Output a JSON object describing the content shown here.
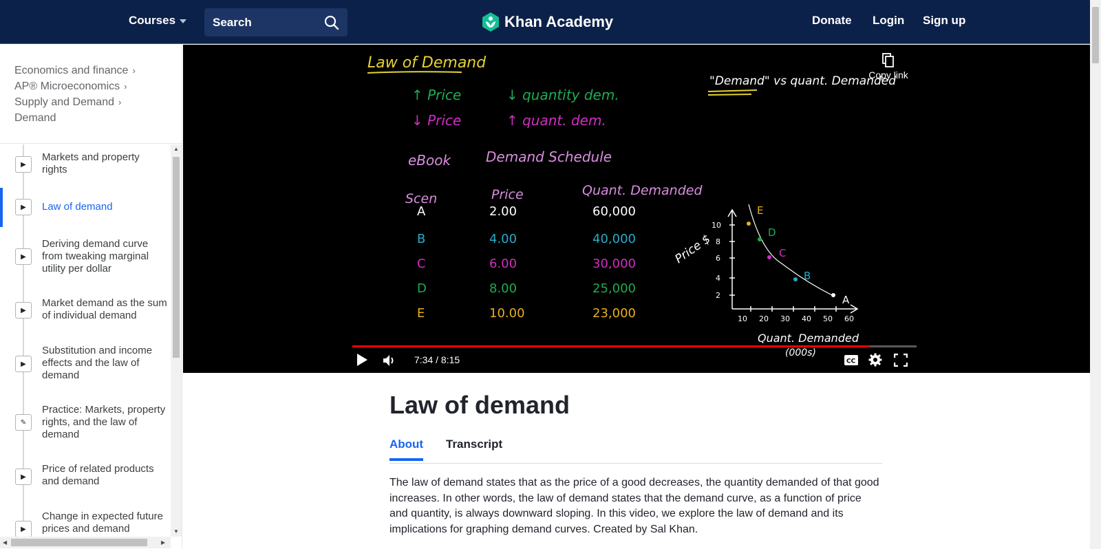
{
  "header": {
    "courses_label": "Courses",
    "search_label": "Search",
    "brand": "Khan Academy",
    "donate": "Donate",
    "login": "Login",
    "signup": "Sign up"
  },
  "breadcrumbs": [
    "Economics and finance",
    "AP® Microeconomics",
    "Supply and Demand",
    "Demand"
  ],
  "lessons": [
    {
      "title": "Markets and property rights",
      "kind": "video"
    },
    {
      "title": "Law of demand",
      "kind": "video",
      "active": true
    },
    {
      "title": "Deriving demand curve from tweaking marginal utility per dollar",
      "kind": "video"
    },
    {
      "title": "Market demand as the sum of individual demand",
      "kind": "video"
    },
    {
      "title": "Substitution and income effects and the law of demand",
      "kind": "video"
    },
    {
      "title": "Practice: Markets, property rights, and the law of demand",
      "kind": "exercise"
    },
    {
      "title": "Price of related products and demand",
      "kind": "video"
    },
    {
      "title": "Change in expected future prices and demand",
      "kind": "video"
    }
  ],
  "video": {
    "time": "7:34 / 8:15",
    "progress": 0.917,
    "copy_link": "Copy link",
    "board": {
      "title": "Law of Demand",
      "rule1_left": "↑ Price",
      "rule1_right": "↓ quantity dem.",
      "rule2_left": "↓ Price",
      "rule2_right": "↑ quant. dem.",
      "demand_vs": "\"Demand\" vs quant. Demanded",
      "ebook": "eBook",
      "schedule": "Demand Schedule",
      "col_scen": "Scen",
      "col_price": "Price",
      "col_qty": "Quant. Demanded",
      "rows": [
        {
          "scen": "A",
          "price": "2.00",
          "qty": "60,000",
          "color": "#ffffff"
        },
        {
          "scen": "B",
          "price": "4.00",
          "qty": "40,000",
          "color": "#29abca"
        },
        {
          "scen": "C",
          "price": "6.00",
          "qty": "30,000",
          "color": "#d12ec1"
        },
        {
          "scen": "D",
          "price": "8.00",
          "qty": "25,000",
          "color": "#1fab54"
        },
        {
          "scen": "E",
          "price": "10.00",
          "qty": "23,000",
          "color": "#e8b01c"
        }
      ],
      "graph_ylabel": "Price $",
      "graph_xlabel": "Quant. Demanded",
      "graph_xunit": "(000s)",
      "y_ticks": [
        "10",
        "8",
        "6",
        "4",
        "2"
      ],
      "x_ticks": [
        "10",
        "20",
        "30",
        "40",
        "50",
        "60"
      ]
    }
  },
  "main": {
    "title": "Law of demand",
    "tabs": [
      "About",
      "Transcript"
    ],
    "description": "The law of demand states that as the price of a good decreases, the quantity demanded of that good increases. In other words, the law of demand states that the demand curve, as a function of price and quantity, is always downward sloping. In this video, we explore the law of demand and its implications for graphing demand curves.  Created by Sal Khan."
  },
  "colors": {
    "header_bg": "#0b2149",
    "accent": "#1865f2",
    "progress": "#ff0000"
  }
}
